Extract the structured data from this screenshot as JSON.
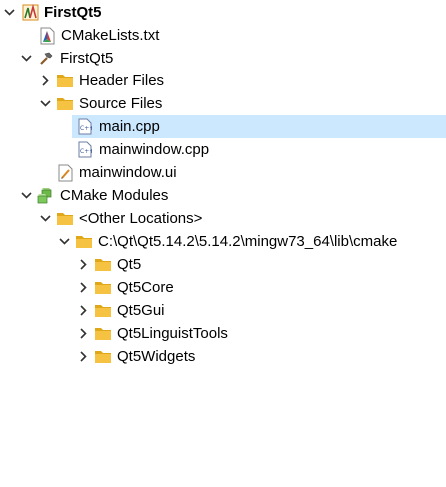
{
  "project": {
    "name": "FirstQt5",
    "cmakelists": "CMakeLists.txt",
    "target": "FirstQt5",
    "header_files": "Header Files",
    "source_files": "Source Files",
    "main_cpp": "main.cpp",
    "mainwindow_cpp": "mainwindow.cpp",
    "mainwindow_ui": "mainwindow.ui",
    "cmake_modules": "CMake Modules",
    "other_locations": "<Other Locations>",
    "cmake_path": "C:\\Qt\\Qt5.14.2\\5.14.2\\mingw73_64\\lib\\cmake",
    "qt5": "Qt5",
    "qt5core": "Qt5Core",
    "qt5gui": "Qt5Gui",
    "qt5linguisttools": "Qt5LinguistTools",
    "qt5widgets": "Qt5Widgets"
  },
  "colors": {
    "selection": "#cce8ff",
    "folder": "#f5c242",
    "folder_dark": "#e0a818"
  }
}
